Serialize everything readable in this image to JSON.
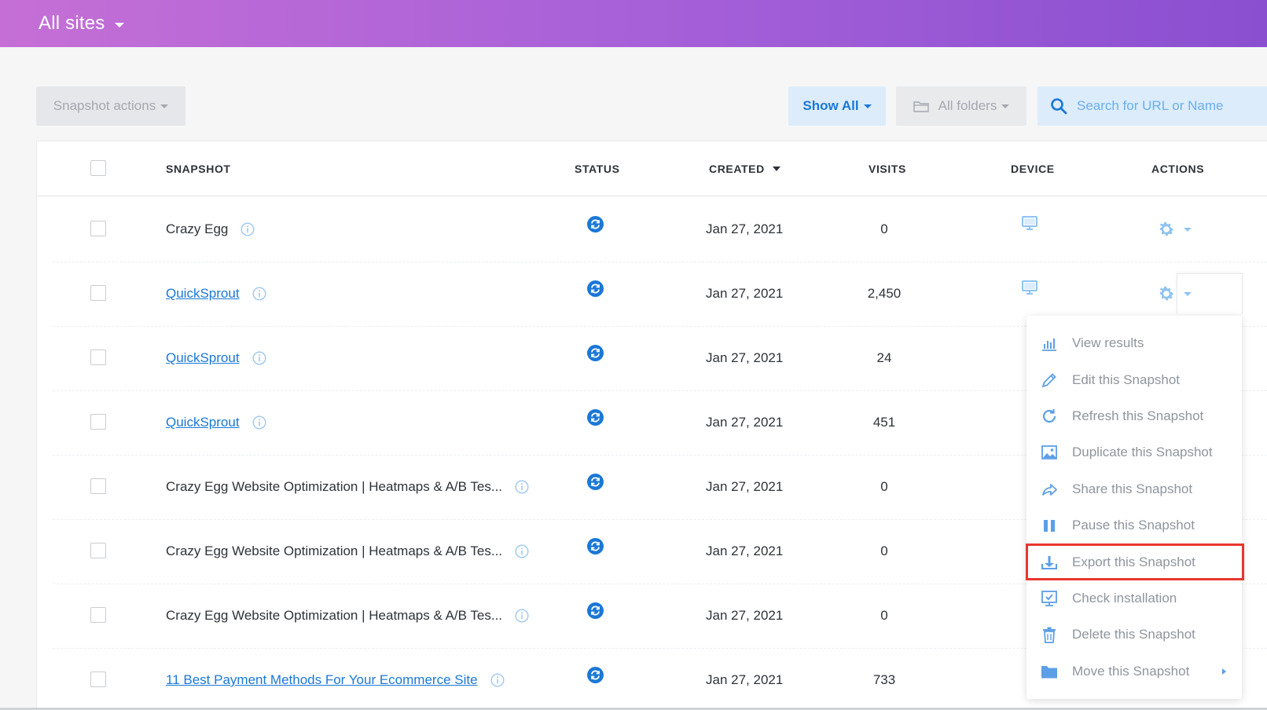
{
  "header": {
    "title": "All sites"
  },
  "toolbar": {
    "snapshot_actions": "Snapshot actions",
    "show_all": "Show All",
    "all_folders": "All folders",
    "search_placeholder": "Search for URL or Name"
  },
  "table": {
    "columns": {
      "snapshot": "SNAPSHOT",
      "status": "STATUS",
      "created": "CREATED",
      "visits": "VISITS",
      "device": "DEVICE",
      "actions": "ACTIONS"
    },
    "rows": [
      {
        "name": "Crazy Egg",
        "link": false,
        "status_icon": "refresh-status-icon",
        "created": "Jan 27, 2021",
        "visits": "0",
        "device_icon": "desktop-icon"
      },
      {
        "name": "QuickSprout",
        "link": true,
        "status_icon": "refresh-status-icon",
        "created": "Jan 27, 2021",
        "visits": "2,450",
        "device_icon": "desktop-icon"
      },
      {
        "name": "QuickSprout",
        "link": true,
        "status_icon": "refresh-status-icon",
        "created": "Jan 27, 2021",
        "visits": "24",
        "device_icon": ""
      },
      {
        "name": "QuickSprout",
        "link": true,
        "status_icon": "refresh-status-icon",
        "created": "Jan 27, 2021",
        "visits": "451",
        "device_icon": ""
      },
      {
        "name": "Crazy Egg Website Optimization | Heatmaps & A/B Tes...",
        "link": false,
        "status_icon": "refresh-status-icon",
        "created": "Jan 27, 2021",
        "visits": "0",
        "device_icon": ""
      },
      {
        "name": "Crazy Egg Website Optimization | Heatmaps & A/B Tes...",
        "link": false,
        "status_icon": "refresh-status-icon",
        "created": "Jan 27, 2021",
        "visits": "0",
        "device_icon": ""
      },
      {
        "name": "Crazy Egg Website Optimization | Heatmaps & A/B Tes...",
        "link": false,
        "status_icon": "refresh-status-icon",
        "created": "Jan 27, 2021",
        "visits": "0",
        "device_icon": ""
      },
      {
        "name": "11 Best Payment Methods For Your Ecommerce Site",
        "link": true,
        "status_icon": "refresh-status-icon",
        "created": "Jan 27, 2021",
        "visits": "733",
        "device_icon": ""
      }
    ]
  },
  "actions_menu": {
    "items": [
      {
        "label": "View results",
        "icon": "bar-chart-icon"
      },
      {
        "label": "Edit this Snapshot",
        "icon": "pencil-icon"
      },
      {
        "label": "Refresh this Snapshot",
        "icon": "refresh-icon"
      },
      {
        "label": "Duplicate this Snapshot",
        "icon": "image-duplicate-icon"
      },
      {
        "label": "Share this Snapshot",
        "icon": "share-arrow-icon"
      },
      {
        "label": "Pause this Snapshot",
        "icon": "pause-icon"
      },
      {
        "label": "Export this Snapshot",
        "icon": "export-icon",
        "highlighted": true
      },
      {
        "label": "Check installation",
        "icon": "monitor-check-icon"
      },
      {
        "label": "Delete this Snapshot",
        "icon": "trash-icon"
      },
      {
        "label": "Move this Snapshot",
        "icon": "folder-icon",
        "submenu": true
      }
    ]
  },
  "colors": {
    "accent": "#1a78d6",
    "highlight": "#e8362f",
    "header_start": "#c56fd6",
    "header_end": "#8a4fd0"
  }
}
